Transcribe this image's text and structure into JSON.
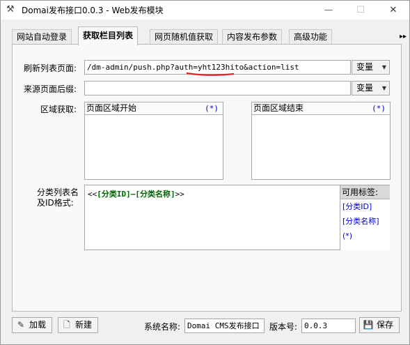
{
  "window": {
    "title": "Domai发布接口0.0.3 - Web发布模块",
    "minimize_glyph": "—",
    "maximize_glyph": "☐",
    "close_glyph": "✕"
  },
  "tabs": [
    {
      "label": "网站自动登录"
    },
    {
      "label": "获取栏目列表"
    },
    {
      "label": "网页随机值获取"
    },
    {
      "label": "内容发布参数"
    },
    {
      "label": "高级功能"
    }
  ],
  "tab_scroll_glyph": "▸▸",
  "form": {
    "refresh_label": "刷新列表页面:",
    "refresh_url": "/dm-admin/push.php?auth=yht123hito&action=list",
    "var_button": "变量",
    "source_suffix_label": "来源页面后缀:",
    "source_suffix_value": "",
    "region_label": "区域获取:",
    "region_start": {
      "title": "页面区域开始",
      "star": "(*)"
    },
    "region_end": {
      "title": "页面区域结束",
      "star": "(*)"
    },
    "format_label_line1": "分类列表名",
    "format_label_line2": "及ID格式:",
    "format_prefix": "<<",
    "format_tag1": "[分类ID]",
    "format_sep": "—",
    "format_tag2": "[分类名称]",
    "format_suffix": ">>",
    "tags_header": "可用标签:",
    "tags": [
      "[分类ID]",
      "[分类名称]",
      "(*)"
    ]
  },
  "footer": {
    "load_button": "加载",
    "new_button": "新建",
    "system_name_label": "系统名称:",
    "system_name_value": "Domai CMS发布接口",
    "version_label": "版本号:",
    "version_value": "0.0.3",
    "save_button": "保存"
  },
  "colors": {
    "accent_underline": "#e0242a",
    "tag_green": "#006600",
    "tag_blue": "#0000cc"
  }
}
